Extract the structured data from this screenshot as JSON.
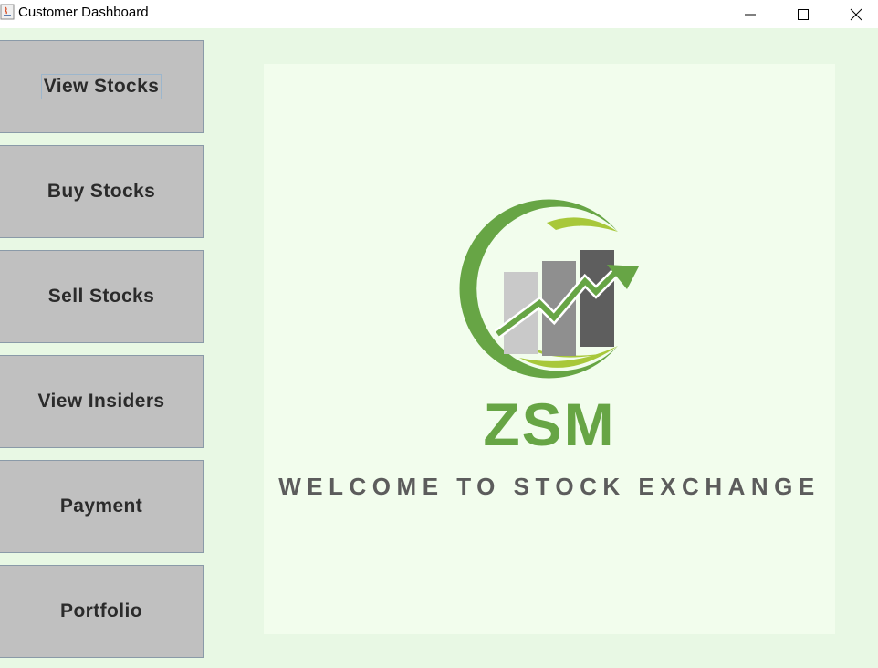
{
  "window": {
    "title": "Customer Dashboard",
    "icons": [
      "java-app-icon",
      "minimize-icon",
      "maximize-icon",
      "close-icon"
    ]
  },
  "sidebar": {
    "buttons": [
      {
        "label": "View Stocks",
        "focused": true
      },
      {
        "label": "Buy Stocks"
      },
      {
        "label": "Sell Stocks"
      },
      {
        "label": "View Insiders"
      },
      {
        "label": "Payment"
      },
      {
        "label": "Portfolio"
      }
    ]
  },
  "welcome": {
    "brand": "ZSM",
    "tagline": "WELCOME TO STOCK EXCHANGE"
  },
  "colors": {
    "background": "#e8f8e4",
    "panel": "#f2fded",
    "button": "#c0c0c0",
    "brand_green": "#67a545",
    "accent_lime": "#a8c83a",
    "tagline": "#5c5c5c"
  }
}
